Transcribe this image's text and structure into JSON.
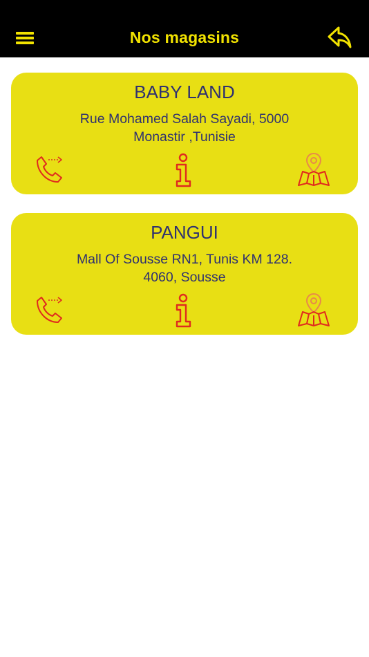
{
  "header": {
    "title": "Nos magasins",
    "icons": {
      "menu": "hamburger-menu-icon",
      "back": "reply-arrow-icon"
    }
  },
  "stores": [
    {
      "name": "BABY LAND",
      "address_line1": "Rue Mohamed Salah Sayadi, 5000",
      "address_line2": "Monastir ,Tunisie"
    },
    {
      "name": "PANGUI",
      "address_line1": "Mall Of Sousse RN1, Tunis KM 128.",
      "address_line2": "4060, Sousse"
    }
  ],
  "card_icons": {
    "call": "phone-call-icon",
    "info": "info-icon",
    "map": "map-location-icon"
  },
  "colors": {
    "header_bg": "#000000",
    "accent_yellow": "#f2e300",
    "card_bg": "#e8df14",
    "text_navy": "#2f3170",
    "icon_red": "#e02a1e"
  }
}
